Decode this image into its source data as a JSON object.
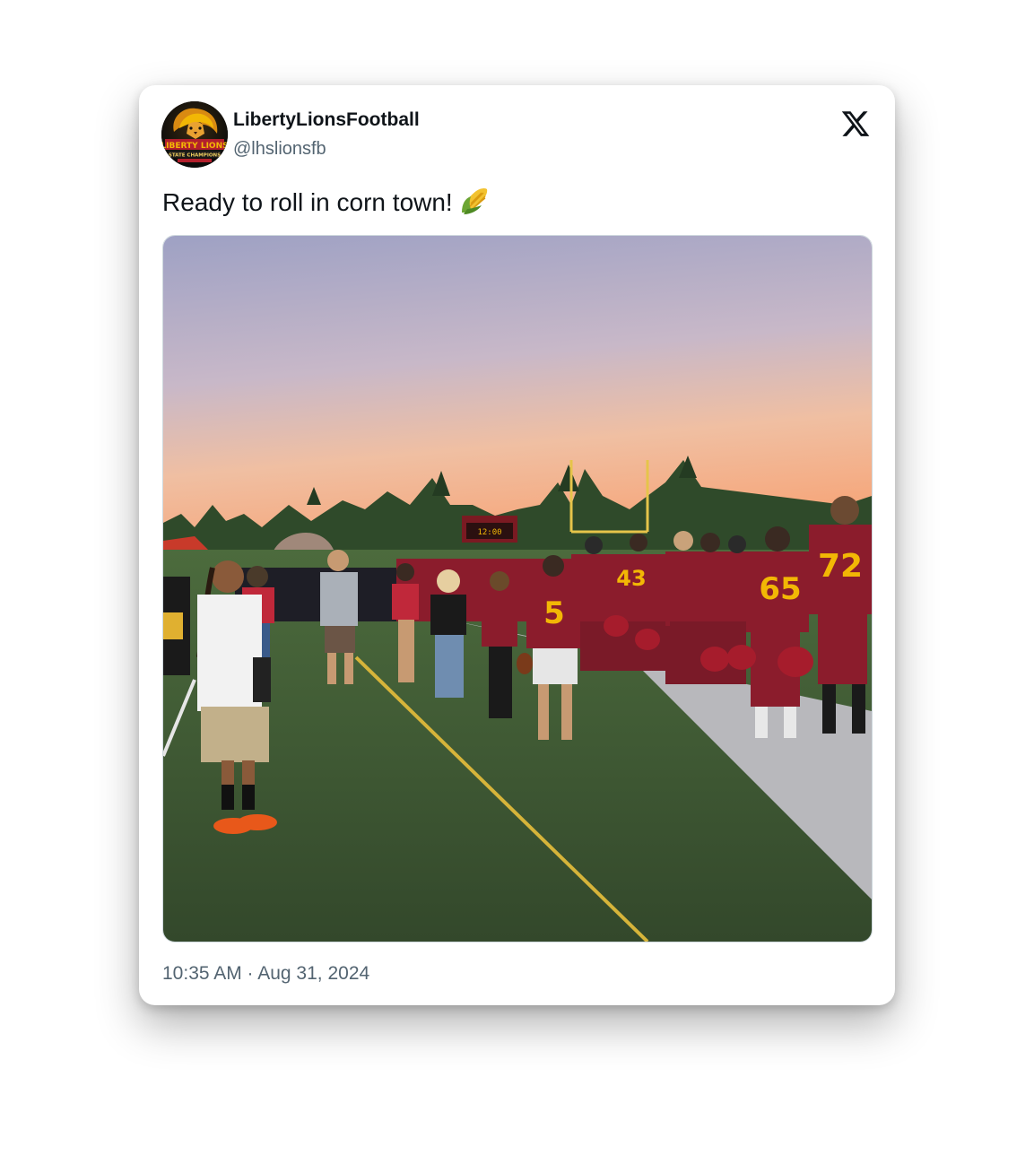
{
  "tweet": {
    "display_name": "LibertyLionsFootball",
    "handle": "@lhslionsfb",
    "text": "Ready to roll in corn town!",
    "emoji": "corn-emoji",
    "timestamp": "10:35 AM · Aug 31, 2024"
  },
  "avatar": {
    "logo_text_top": "LIBERTY LIONS",
    "logo_text_bottom": "STATE CHAMPIONS"
  },
  "media": {
    "description_icon": "photo",
    "jersey_numbers": [
      "5",
      "65",
      "72",
      "43"
    ]
  },
  "colors": {
    "text_primary": "#0f1419",
    "text_secondary": "#536471",
    "jersey_maroon": "#8b1c2c",
    "jersey_gold": "#f2b705",
    "turf_green": "#3f5a35",
    "sky_top": "#a9a8c8",
    "sky_bottom": "#f4b08a"
  }
}
